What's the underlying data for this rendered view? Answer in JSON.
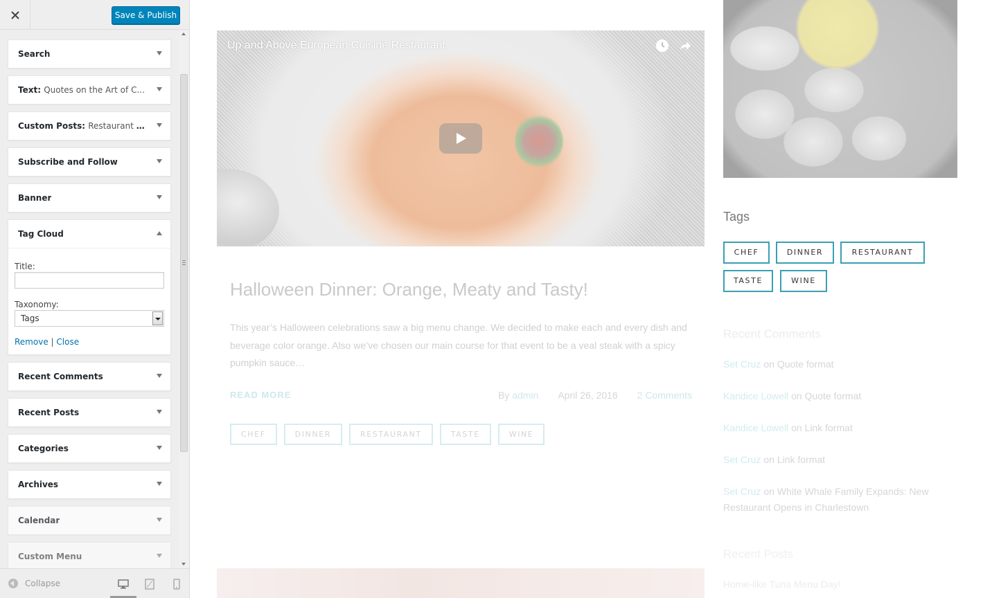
{
  "sidebar": {
    "publish_label": "Save & Publish",
    "widgets": [
      {
        "title": "Search",
        "sub": ""
      },
      {
        "title": "Text:",
        "sub": "Quotes on the Art of C..."
      },
      {
        "title": "Custom Posts:",
        "sub": "Restaurant Ev..."
      },
      {
        "title": "Subscribe and Follow",
        "sub": ""
      },
      {
        "title": "Banner",
        "sub": ""
      },
      {
        "title": "Tag Cloud",
        "sub": ""
      },
      {
        "title": "Recent Comments",
        "sub": ""
      },
      {
        "title": "Recent Posts",
        "sub": ""
      },
      {
        "title": "Categories",
        "sub": ""
      },
      {
        "title": "Archives",
        "sub": ""
      },
      {
        "title": "Calendar",
        "sub": ""
      },
      {
        "title": "Custom Menu",
        "sub": ""
      }
    ],
    "tag_cloud_form": {
      "title_label": "Title:",
      "title_value": "",
      "taxonomy_label": "Taxonomy:",
      "taxonomy_selected": "Tags",
      "remove_label": "Remove",
      "separator": "|",
      "close_label": "Close"
    },
    "collapse_label": "Collapse"
  },
  "preview": {
    "video": {
      "title": "Up and Above European Cuisine Restaurant"
    },
    "post": {
      "title": "Halloween Dinner: Orange, Meaty and Tasty!",
      "excerpt": "This year’s Halloween celebrations saw a big menu change. We decided to make each and every dish and beverage color orange. Also we’ve chosen our main course for that event to be a veal steak with a spicy pumpkin sauce…",
      "read_more": "READ MORE",
      "by": "By",
      "author": "admin",
      "date": "April 26, 2016",
      "comments": "2 Comments",
      "tags": [
        "CHEF",
        "DINNER",
        "RESTAURANT",
        "TASTE",
        "WINE"
      ]
    },
    "tags_widget": {
      "heading": "Tags",
      "tags": [
        "CHEF",
        "DINNER",
        "RESTAURANT",
        "TASTE",
        "WINE"
      ]
    },
    "recent_comments": {
      "heading": "Recent Comments",
      "items": [
        {
          "author": "Set Cruz",
          "on": "on",
          "post": "Quote format"
        },
        {
          "author": "Kandice Lowell",
          "on": "on",
          "post": "Quote format"
        },
        {
          "author": "Kandice Lowell",
          "on": "on",
          "post": "Link format"
        },
        {
          "author": "Set Cruz",
          "on": "on",
          "post": "Link format"
        },
        {
          "author": "Set Cruz",
          "on": "on",
          "post": "White Whale Family Expands: New Restaurant Opens in Charlestown"
        }
      ]
    },
    "recent_posts": {
      "heading": "Recent Posts",
      "first": "Home-like Tuna Menu Day!"
    }
  },
  "colors": {
    "accent": "#0085ba",
    "tag_border": "#3a9fb2",
    "link": "#0073aa"
  }
}
